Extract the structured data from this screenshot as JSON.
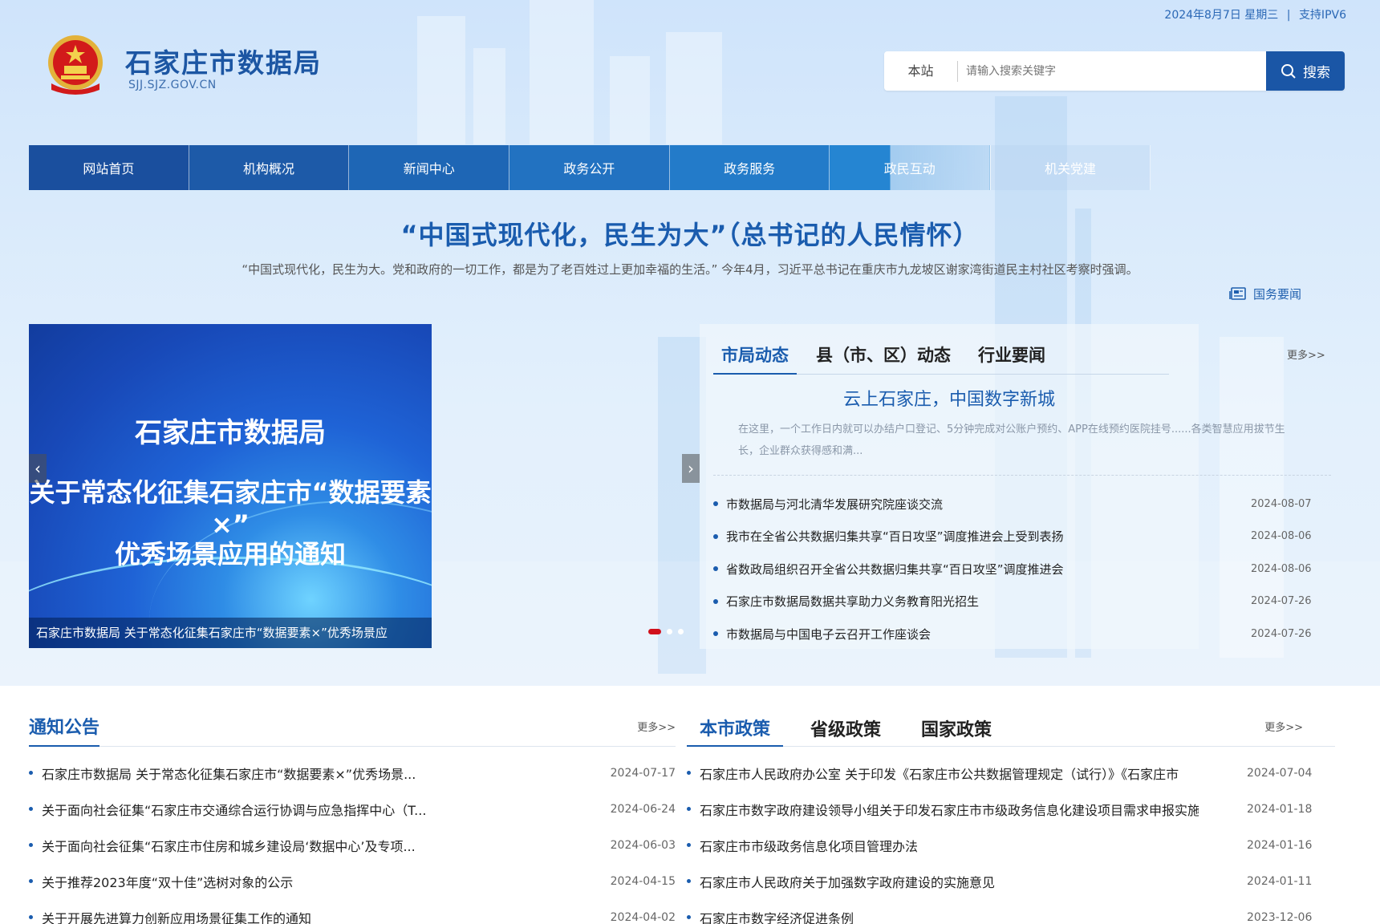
{
  "top": {
    "date": "2024年8月7日 星期三",
    "sep": "|",
    "ipv6": "支持IPV6"
  },
  "site": {
    "title": "石家庄市数据局",
    "domain": "SJJ.SJZ.GOV.CN"
  },
  "search": {
    "scope": "本站",
    "placeholder": "请输入搜索关键字",
    "button": "搜索"
  },
  "nav": [
    "网站首页",
    "机构概况",
    "新闻中心",
    "政务公开",
    "政务服务",
    "政民互动",
    "机关党建"
  ],
  "headline": {
    "title": "“中国式现代化，民生为大”（总书记的人民情怀）",
    "sub": "“中国式现代化，民生为大。党和政府的一切工作，都是为了老百姓过上更加幸福的生活。” 今年4月，习近平总书记在重庆市九龙坡区谢家湾街道民主村社区考察时强调。"
  },
  "gwyw": "国务要闻",
  "slider": {
    "line1": "石家庄市数据局",
    "line2": "关于常态化征集石家庄市“数据要素×”",
    "line3": "优秀场景应用的通知",
    "caption": "石家庄市数据局 关于常态化征集石家庄市“数据要素×”优秀场景应",
    "prev": "‹",
    "next": "›"
  },
  "dynamics": {
    "tabs": [
      "市局动态",
      "县（市、区）动态",
      "行业要闻"
    ],
    "more": "更多>>",
    "feature_title": "云上石家庄，中国数字新城",
    "feature_desc": "在这里，一个工作日内就可以办结户口登记、5分钟完成对公账户预约、APP在线预约医院挂号......各类智慧应用拔节生长，企业群众获得感和满...",
    "items": [
      {
        "title": "市数据局与河北清华发展研究院座谈交流",
        "date": "2024-08-07"
      },
      {
        "title": "我市在全省公共数据归集共享“百日攻坚”调度推进会上受到表扬",
        "date": "2024-08-06"
      },
      {
        "title": "省数政局组织召开全省公共数据归集共享“百日攻坚”调度推进会",
        "date": "2024-08-06"
      },
      {
        "title": "石家庄市数据局数据共享助力义务教育阳光招生",
        "date": "2024-07-26"
      },
      {
        "title": "市数据局与中国电子云召开工作座谈会",
        "date": "2024-07-26"
      }
    ]
  },
  "notices": {
    "title": "通知公告",
    "more": "更多>>",
    "items": [
      {
        "title": "石家庄市数据局 关于常态化征集石家庄市“数据要素×”优秀场景...",
        "date": "2024-07-17"
      },
      {
        "title": "关于面向社会征集“石家庄市交通综合运行协调与应急指挥中心（T...",
        "date": "2024-06-24"
      },
      {
        "title": "关于面向社会征集“石家庄市住房和城乡建设局‘数据中心’及专项...",
        "date": "2024-06-03"
      },
      {
        "title": "关于推荐2023年度“双十佳”选树对象的公示",
        "date": "2024-04-15"
      },
      {
        "title": "关于开展先进算力创新应用场景征集工作的通知",
        "date": "2024-04-02"
      }
    ]
  },
  "policies": {
    "tabs": [
      "本市政策",
      "省级政策",
      "国家政策"
    ],
    "more": "更多>>",
    "items": [
      {
        "title": "石家庄市人民政府办公室 关于印发《石家庄市公共数据管理规定（试行）》《石家庄市",
        "date": "2024-07-04"
      },
      {
        "title": "石家庄市数字政府建设领导小组关于印发石家庄市市级政务信息化建设项目需求申报实施",
        "date": "2024-01-18"
      },
      {
        "title": "石家庄市市级政务信息化项目管理办法",
        "date": "2024-01-16"
      },
      {
        "title": "石家庄市人民政府关于加强数字政府建设的实施意见",
        "date": "2024-01-11"
      },
      {
        "title": "石家庄市数字经济促进条例",
        "date": "2023-12-06"
      }
    ]
  }
}
